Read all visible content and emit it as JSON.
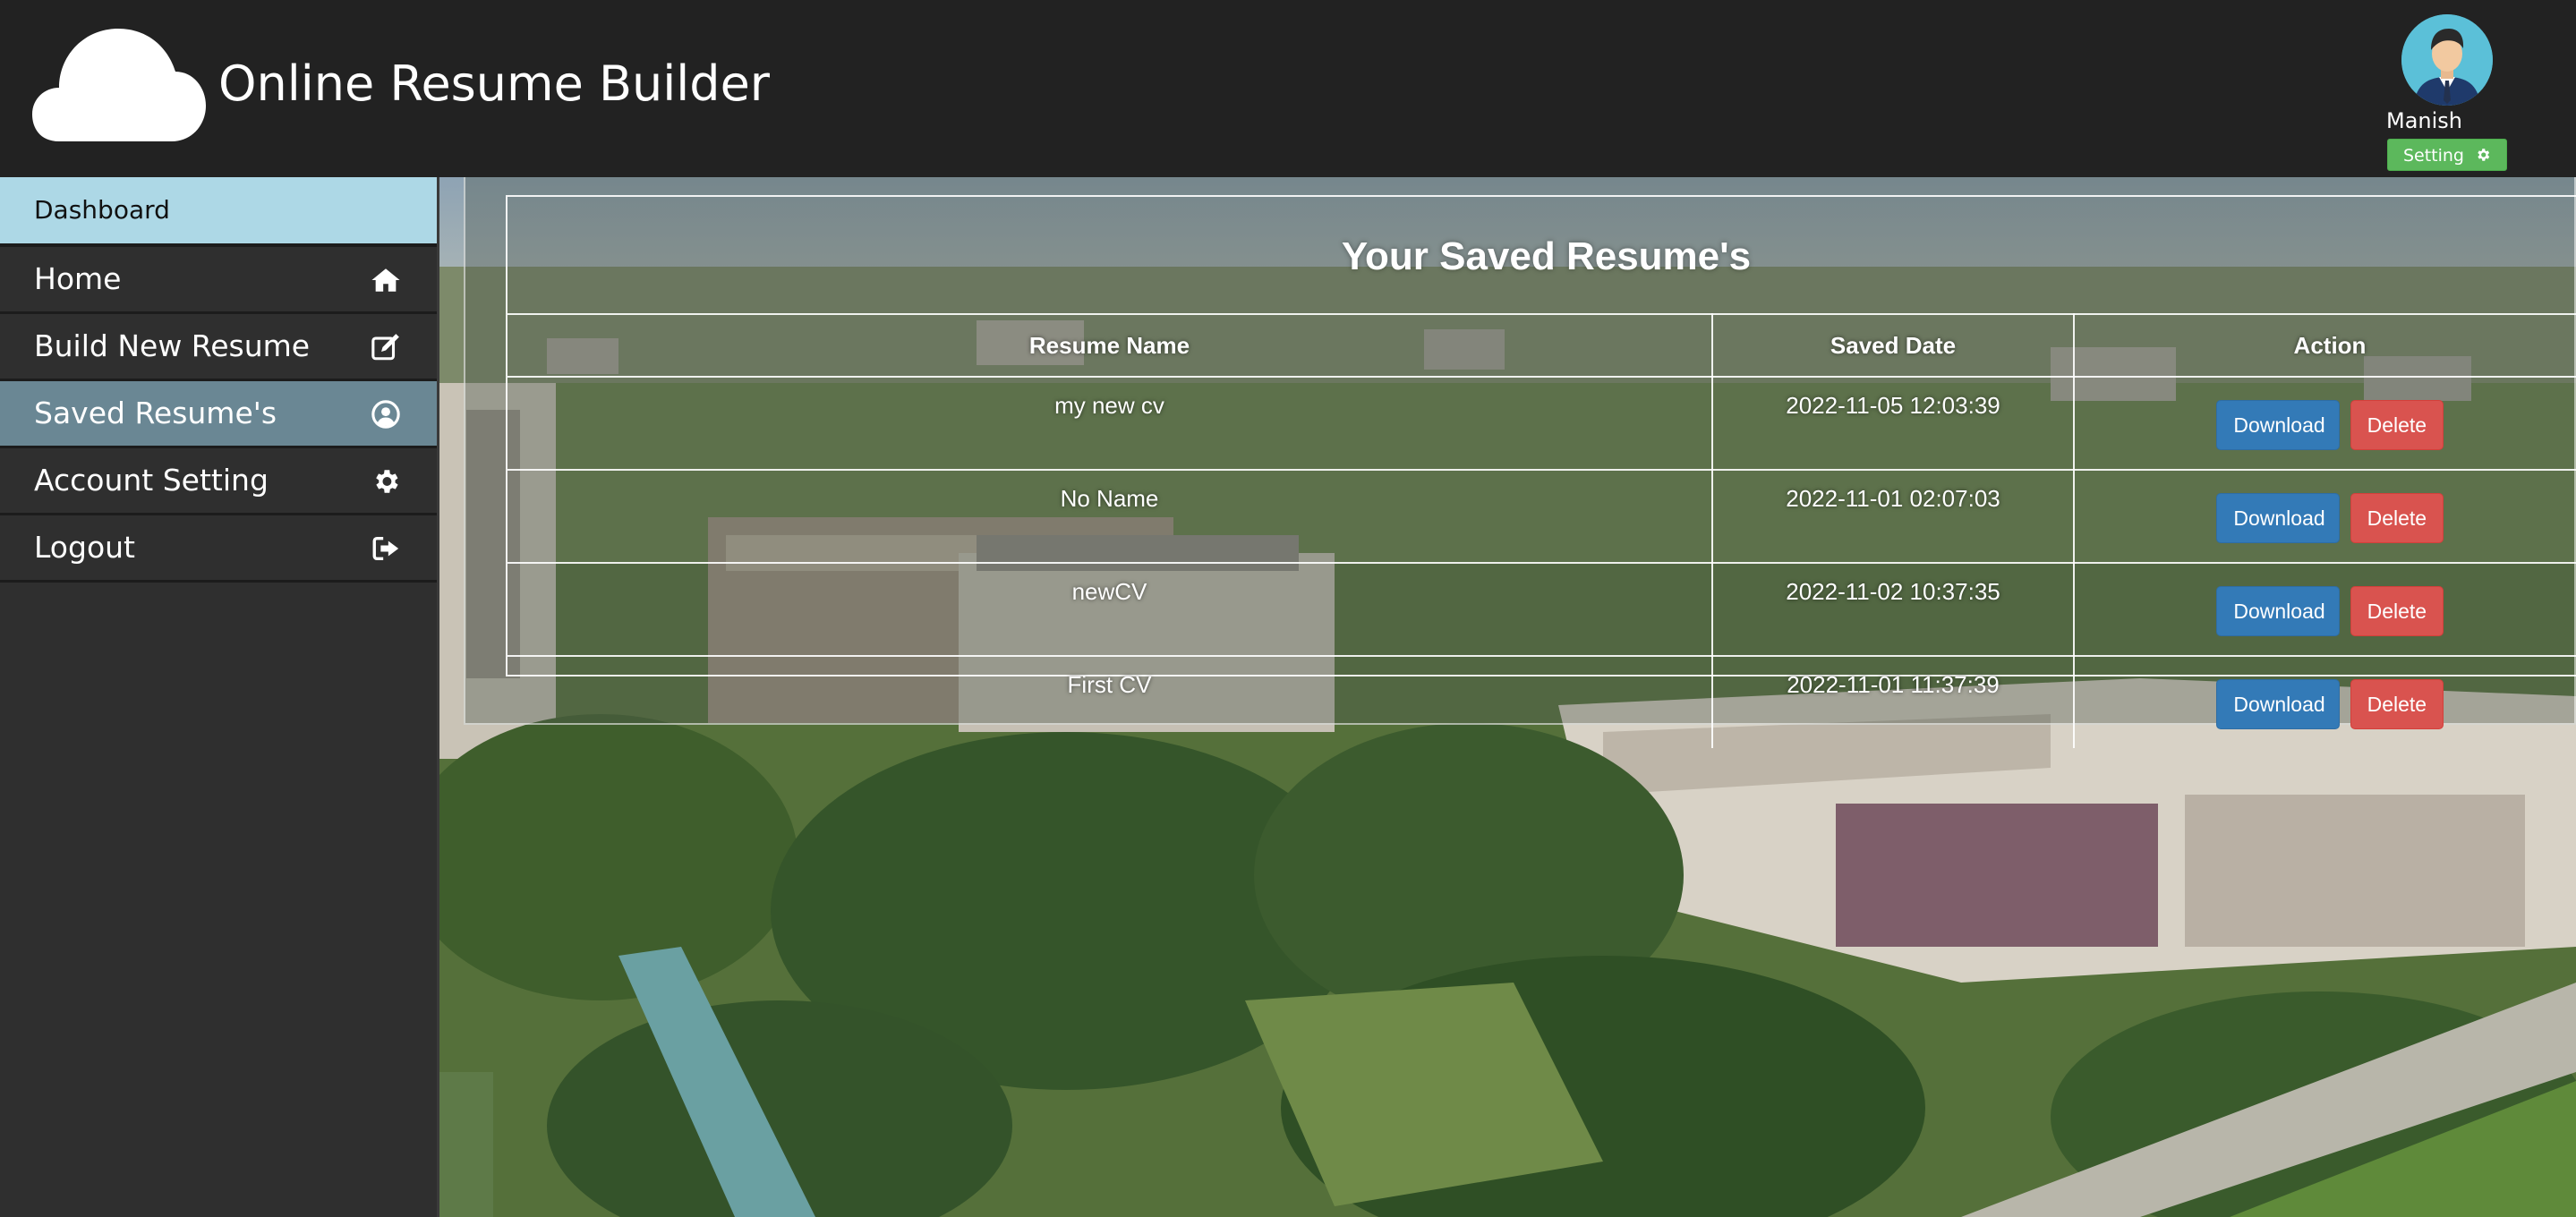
{
  "header": {
    "app_title": "Online Resume Builder",
    "user_name": "Manish",
    "setting_label": "Setting"
  },
  "sidebar": {
    "items": [
      {
        "label": "Dashboard",
        "icon": null
      },
      {
        "label": "Home",
        "icon": "home-icon"
      },
      {
        "label": "Build New Resume",
        "icon": "edit-icon"
      },
      {
        "label": "Saved Resume's",
        "icon": "user-circle-icon"
      },
      {
        "label": "Account Setting",
        "icon": "gear-icon"
      },
      {
        "label": "Logout",
        "icon": "sign-out-icon"
      }
    ]
  },
  "main": {
    "title": "Your Saved Resume's",
    "columns": [
      "Resume Name",
      "Saved Date",
      "Action"
    ],
    "rows": [
      {
        "name": "my new cv",
        "date": "2022-11-05 12:03:39",
        "download": "Download",
        "delete": "Delete"
      },
      {
        "name": "No Name",
        "date": "2022-11-01 02:07:03",
        "download": "Download",
        "delete": "Delete"
      },
      {
        "name": "newCV",
        "date": "2022-11-02 10:37:35",
        "download": "Download",
        "delete": "Delete"
      },
      {
        "name": "First CV",
        "date": "2022-11-01 11:37:39",
        "download": "Download",
        "delete": "Delete"
      }
    ]
  },
  "colors": {
    "header_bg": "#222222",
    "sidebar_bg": "#2f2f2f",
    "dashboard_bg": "#add8e6",
    "active_item_bg": "#6a8794",
    "download_btn": "#337ab7",
    "delete_btn": "#d9534f",
    "setting_btn": "#5cb85c"
  }
}
